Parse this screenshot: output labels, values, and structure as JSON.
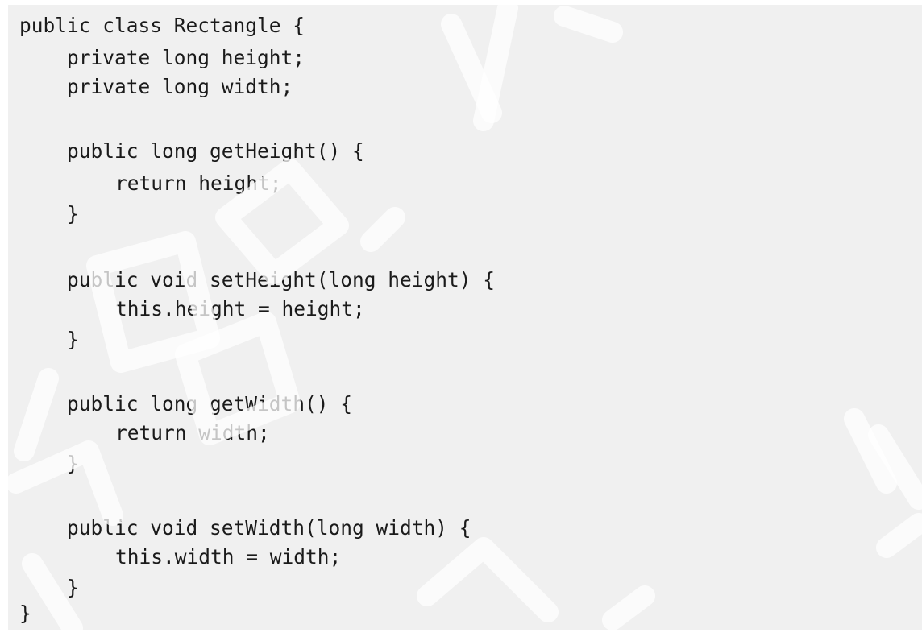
{
  "code": {
    "lines": [
      "public class Rectangle {",
      "private long height;",
      "private long width;",
      "public long getHeight() {",
      "return height;",
      "}",
      "public void setHeight(long height) {",
      "this.height = height;",
      "}",
      "public long getWidth() {",
      "return width;",
      "}",
      "public void setWidth(long width) {",
      "this.width = width;",
      "}",
      "}"
    ]
  },
  "colors": {
    "code_background": "#f0f0f0",
    "code_text": "#1a1a1a",
    "watermark_stroke": "#d9d9d9"
  }
}
